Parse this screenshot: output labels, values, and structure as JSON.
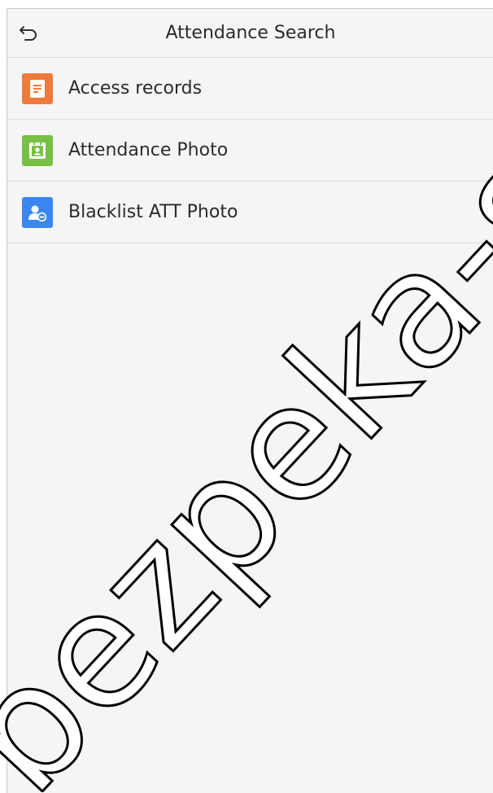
{
  "header": {
    "title": "Attendance Search",
    "back_icon": "back-arrow-icon"
  },
  "menu": {
    "items": [
      {
        "label": "Access records",
        "icon": "document-icon",
        "color": "#f07a3a"
      },
      {
        "label": "Attendance Photo",
        "icon": "id-photo-icon",
        "color": "#77c043"
      },
      {
        "label": "Blacklist ATT Photo",
        "icon": "user-blocked-icon",
        "color": "#3b87f0"
      }
    ]
  },
  "watermark": {
    "text": "bezpeka-shop"
  },
  "colors": {
    "background": "#f5f5f5",
    "divider": "#dcdcdc",
    "text": "#2b2b2b"
  }
}
